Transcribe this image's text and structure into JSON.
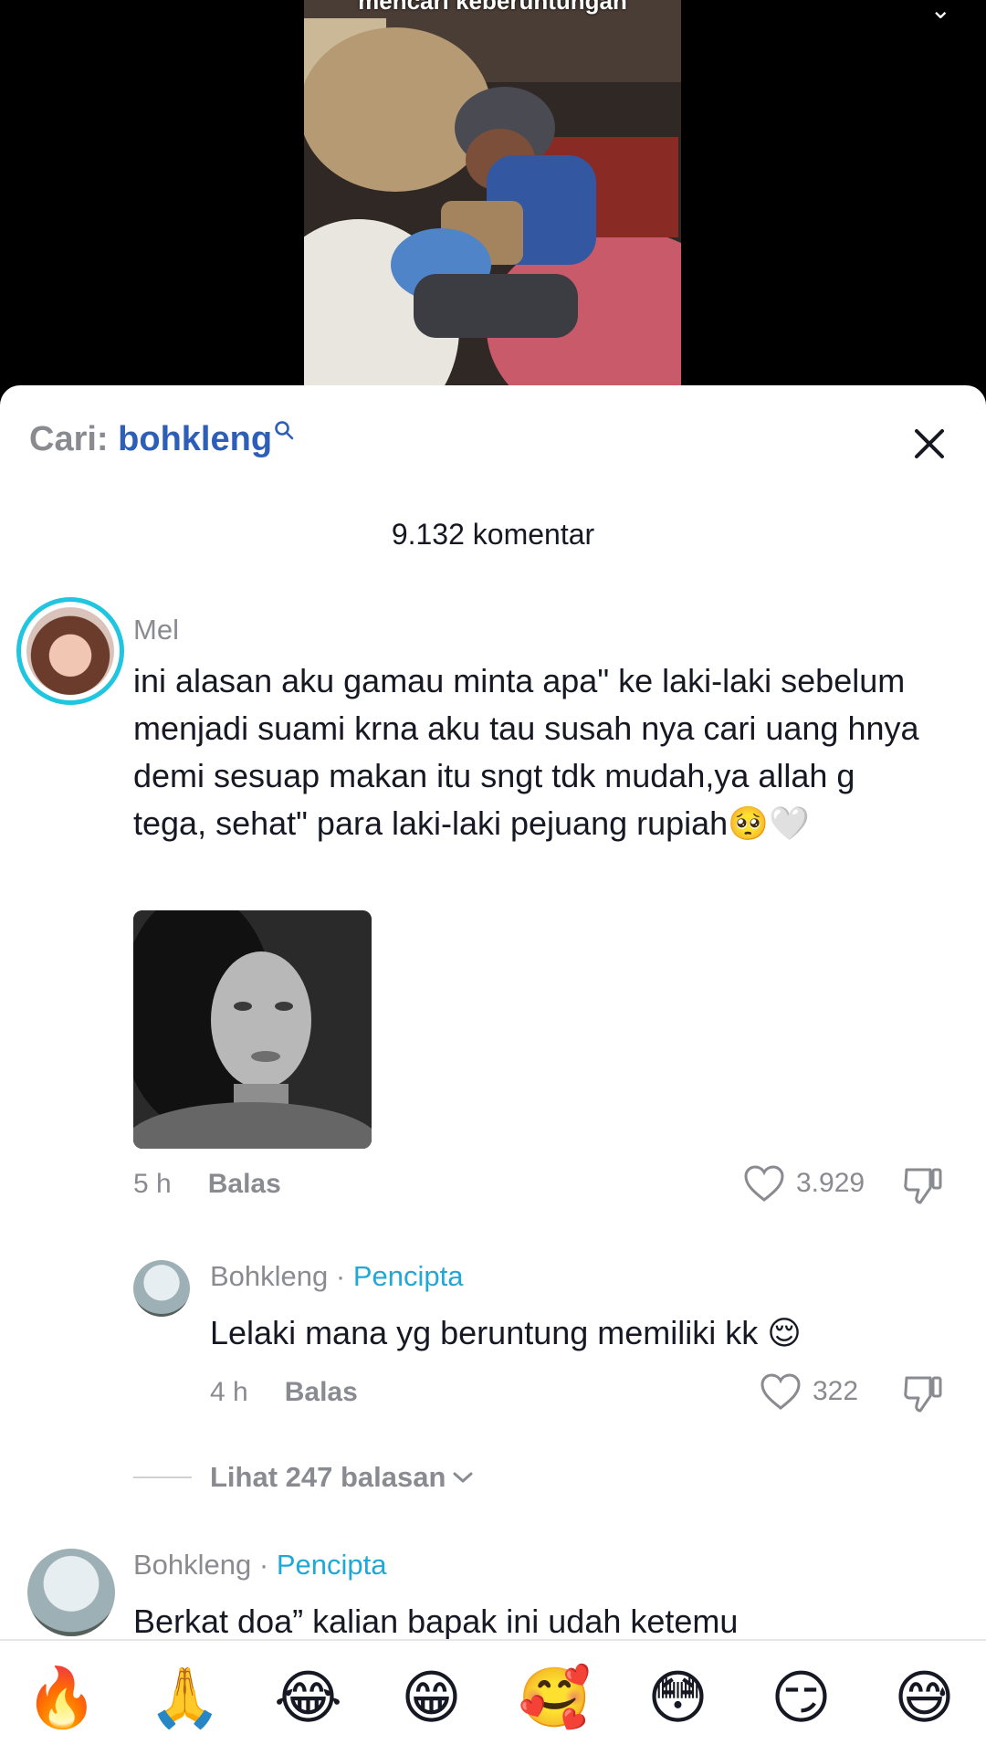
{
  "video": {
    "caption": "mencari keberuntungan",
    "menu_icon": "more-icon"
  },
  "search": {
    "prefix": "Cari:",
    "term": "bohkleng"
  },
  "comments_header": {
    "count_label": "9.132 komentar"
  },
  "comments": [
    {
      "username": "Mel",
      "text": "ini alasan aku gamau minta apa\" ke laki-laki sebelum menjadi suami krna aku tau susah nya cari uang hnya demi sesuap makan itu sngt tdk mudah,ya allah g tega, sehat\" para laki-laki pejuang rupiah🥺🤍",
      "time": "5 h",
      "reply_label": "Balas",
      "likes": "3.929"
    }
  ],
  "replies": [
    {
      "username": "Bohkleng",
      "separator": "·",
      "creator_label": "Pencipta",
      "text": "Lelaki mana yg beruntung memiliki kk 😌",
      "time": "4 h",
      "reply_label": "Balas",
      "likes": "322"
    }
  ],
  "view_replies_label": "Lihat 247 balasan",
  "next_comment": {
    "username": "Bohkleng",
    "separator": "·",
    "creator_label": "Pencipta",
    "text": "Berkat doa” kalian bapak ini udah ketemu"
  },
  "emoji_bar": [
    "🔥",
    "🙏",
    "😂",
    "😁",
    "🥰",
    "😳",
    "😏",
    "😅"
  ],
  "colors": {
    "accent_blue": "#2e5fb8",
    "creator_cyan": "#20a8d8",
    "ring_cyan": "#20c5e0",
    "muted_text": "#8a8b91"
  }
}
